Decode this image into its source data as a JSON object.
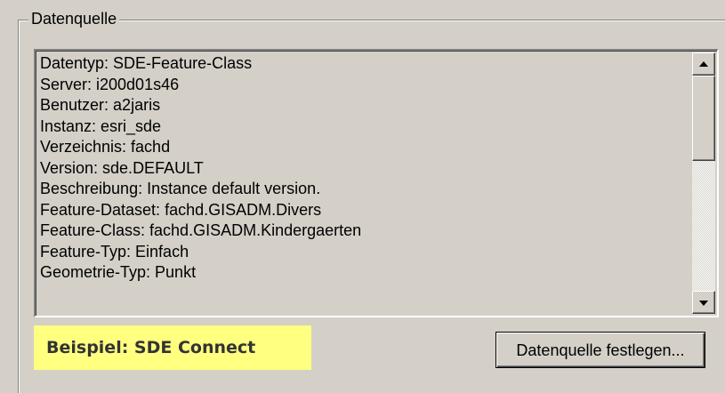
{
  "group": {
    "title": "Datenquelle"
  },
  "datasource_info": {
    "lines": [
      "Datentyp: SDE-Feature-Class",
      "Server: i200d01s46",
      "Benutzer:  a2jaris",
      "Instanz: esri_sde",
      "Verzeichnis: fachd",
      "Version: sde.DEFAULT",
      "Beschreibung: Instance default version.",
      "Feature-Dataset: fachd.GISADM.Divers",
      "Feature-Class: fachd.GISADM.Kindergaerten",
      "Feature-Typ: Einfach",
      "Geometrie-Typ: Punkt"
    ]
  },
  "example_label": "Beispiel: SDE Connect",
  "set_datasource_button": "Datenquelle festlegen...",
  "colors": {
    "dialog_background": "#d4d0c8",
    "example_highlight": "#ffff80"
  },
  "icons": {
    "scroll_up": "arrow-up-icon",
    "scroll_down": "arrow-down-icon"
  }
}
